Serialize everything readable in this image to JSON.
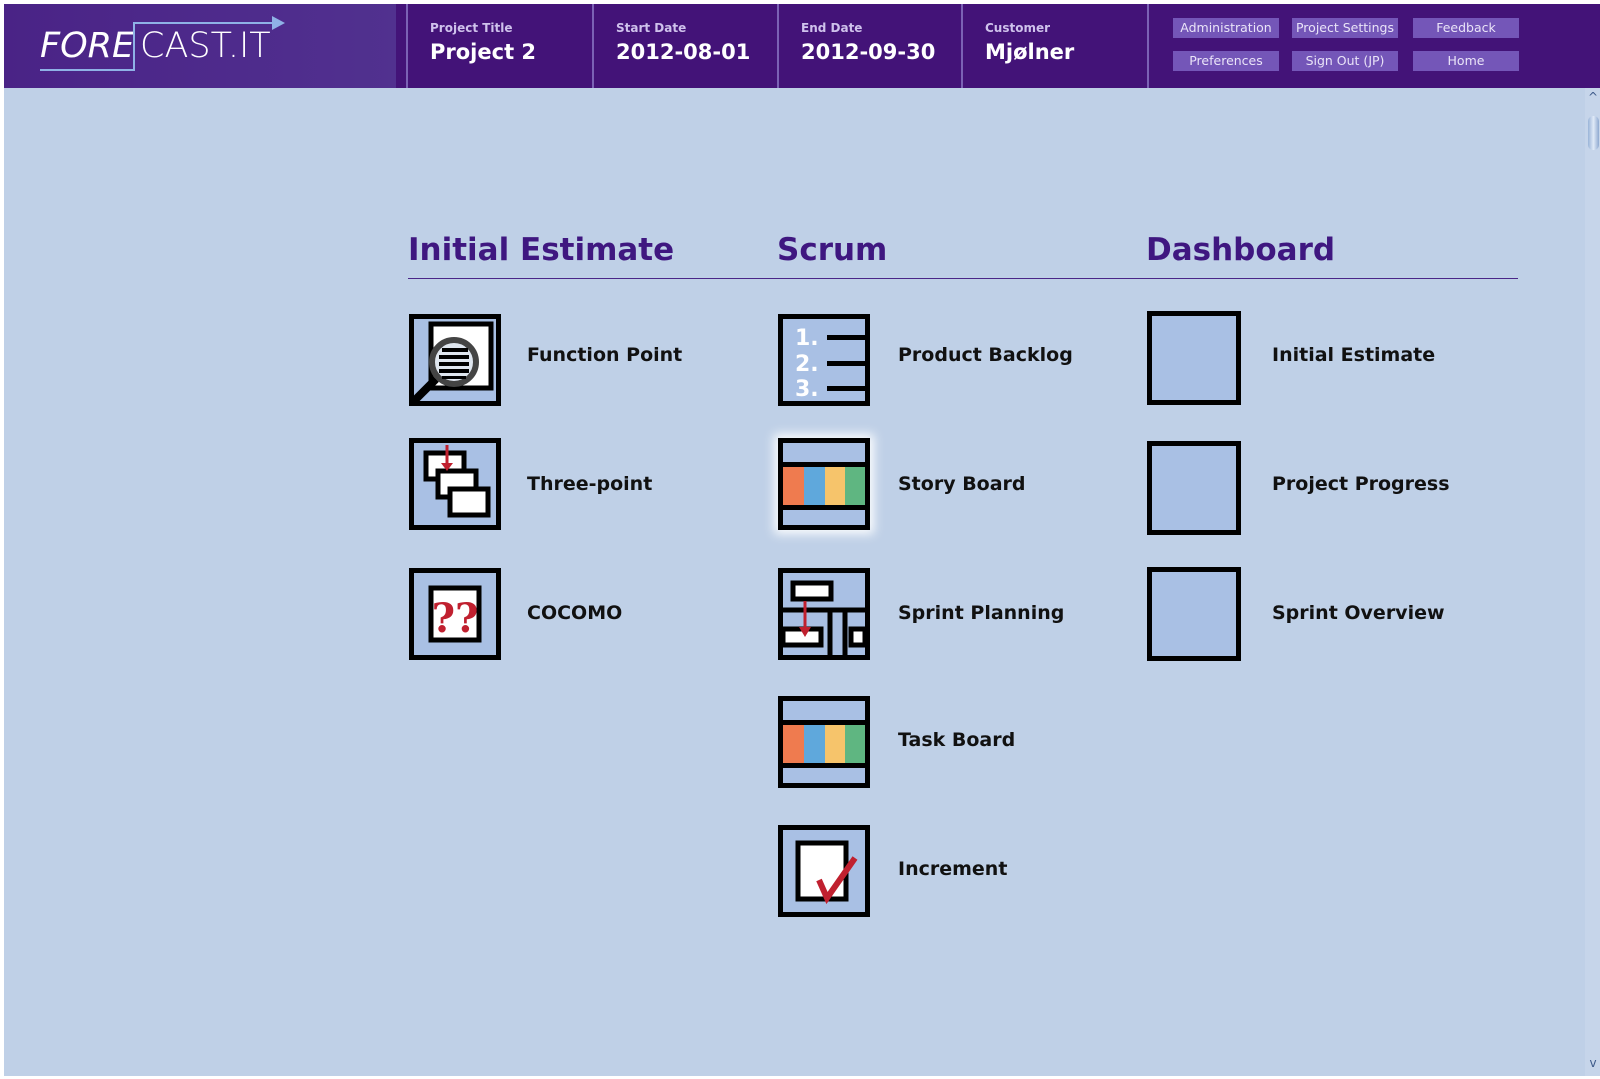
{
  "header": {
    "logo": {
      "left_text": "FORE",
      "right_text": "CAST.IT"
    },
    "project_title": {
      "label": "Project Title",
      "value": "Project 2"
    },
    "start_date": {
      "label": "Start Date",
      "value": "2012-08-01"
    },
    "end_date": {
      "label": "End Date",
      "value": "2012-09-30"
    },
    "customer": {
      "label": "Customer",
      "value": "Mjølner"
    },
    "buttons": {
      "administration": "Administration",
      "project_settings": "Project Settings",
      "feedback": "Feedback",
      "preferences": "Preferences",
      "sign_out": "Sign Out (JP)",
      "home": "Home"
    }
  },
  "sections": {
    "initial_estimate": {
      "title": "Initial Estimate",
      "items": [
        "Function Point",
        "Three-point",
        "COCOMO"
      ]
    },
    "scrum": {
      "title": "Scrum",
      "items": [
        "Product Backlog",
        "Story Board",
        "Sprint Planning",
        "Task Board",
        "Increment"
      ]
    },
    "dashboard": {
      "title": "Dashboard",
      "items": [
        "Initial Estimate",
        "Project Progress",
        "Sprint Overview"
      ]
    }
  },
  "scrollbar": {
    "up_arrow": "^",
    "down_arrow": "v"
  },
  "colors": {
    "header_bg": "#431378",
    "page_bg": "#bfd0e7",
    "title_color": "#3f1780",
    "tile_fill": "#a9c0e4",
    "accent_red": "#c0202f",
    "story_colors": [
      "#ef7b4f",
      "#5fa8dc",
      "#f6c46b",
      "#5fb681"
    ]
  },
  "icons": {
    "function_point": "magnifier-document-icon",
    "three_point": "stacked-cards-icon",
    "cocomo": "question-marks-icon",
    "product_backlog": "numbered-list-icon",
    "story_board": "colored-columns-icon",
    "sprint_planning": "planning-layout-icon",
    "task_board": "colored-columns-icon",
    "increment": "checkmark-document-icon"
  }
}
